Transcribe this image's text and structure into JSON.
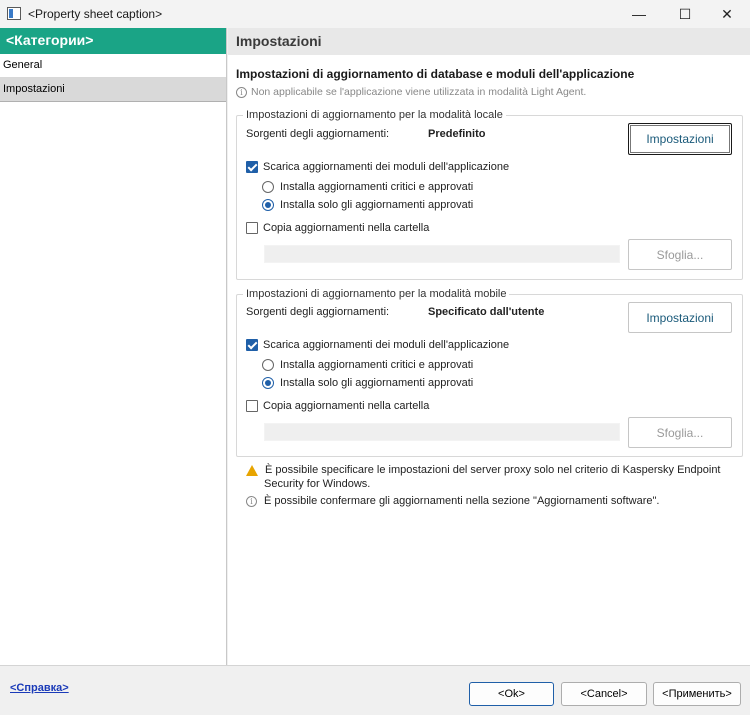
{
  "window": {
    "title": "<Property sheet caption>",
    "min_glyph": "—",
    "max_glyph": "☐",
    "close_glyph": "✕"
  },
  "sidebar": {
    "header": "<Категории>",
    "items": [
      {
        "label": "General",
        "selected": false
      },
      {
        "label": "Impostazioni",
        "selected": true
      }
    ]
  },
  "main": {
    "header": "Impostazioni",
    "section_title": "Impostazioni di aggiornamento di database e moduli dell'applicazione",
    "section_note": "Non applicabile se l'applicazione viene utilizzata in modalità Light Agent.",
    "local": {
      "legend": "Impostazioni di aggiornamento per la modalità locale",
      "sources_label": "Sorgenti degli aggiornamenti:",
      "sources_value": "Predefinito",
      "settings_button": "Impostazioni",
      "download_modules_label": "Scarica aggiornamenti dei moduli dell'applicazione",
      "download_modules_checked": true,
      "radio_critical_label": "Installa aggiornamenti critici e approvati",
      "radio_critical_selected": false,
      "radio_approved_label": "Installa solo gli aggiornamenti approvati",
      "radio_approved_selected": true,
      "copy_folder_label": "Copia aggiornamenti nella cartella",
      "copy_folder_checked": false,
      "browse_button": "Sfoglia..."
    },
    "mobile": {
      "legend": "Impostazioni di aggiornamento per la modalità mobile",
      "sources_label": "Sorgenti degli aggiornamenti:",
      "sources_value": "Specificato dall'utente",
      "settings_button": "Impostazioni",
      "download_modules_label": "Scarica aggiornamenti dei moduli dell'applicazione",
      "download_modules_checked": true,
      "radio_critical_label": "Installa aggiornamenti critici e approvati",
      "radio_critical_selected": false,
      "radio_approved_label": "Installa solo gli aggiornamenti approvati",
      "radio_approved_selected": true,
      "copy_folder_label": "Copia aggiornamenti nella cartella",
      "copy_folder_checked": false,
      "browse_button": "Sfoglia..."
    },
    "notes": {
      "warning_line1": "È possibile specificare le impostazioni del server proxy solo nel criterio di Kaspersky Endpoint",
      "warning_line2": "Security for Windows.",
      "info": "È possibile confermare gli aggiornamenti nella sezione \"Aggiornamenti software\"."
    }
  },
  "footer": {
    "help_link": "<Справка>",
    "ok_button": "<Ok>",
    "cancel_button": "<Cancel>",
    "apply_button": "<Применить>"
  },
  "colors": {
    "sidebar_header": "#1aa486",
    "accent_blue": "#1f5fa8",
    "warning": "#e7a400",
    "link": "#1a3ab8"
  },
  "icons": {
    "app": "property-sheet-app-icon",
    "info": "info-circle-icon",
    "warning": "warning-triangle-icon",
    "checkbox_checked": "checkbox-checked-icon",
    "radio_selected": "radio-selected-icon"
  }
}
